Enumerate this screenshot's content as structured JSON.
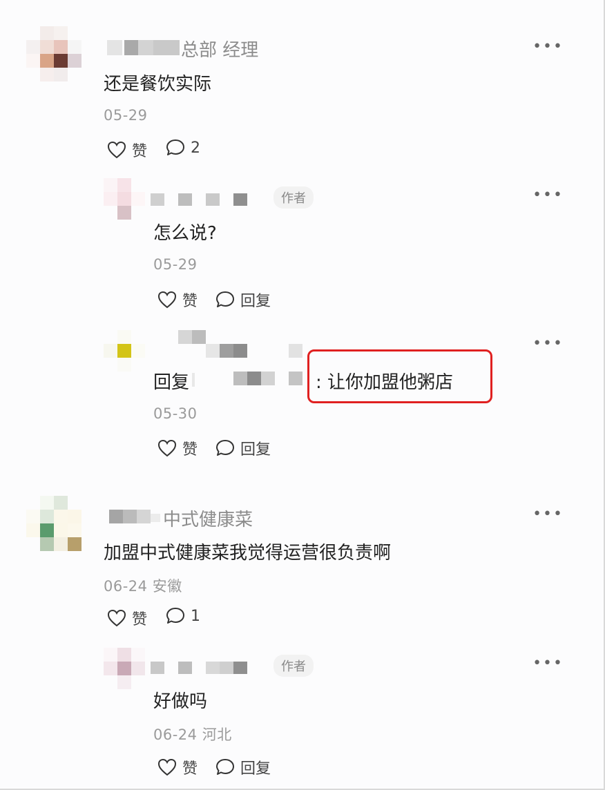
{
  "comments": [
    {
      "name": "总部 经理",
      "text": "还是餐饮实际",
      "date": "05-29",
      "like": "赞",
      "reply_count": "2"
    },
    {
      "name": "",
      "badge": "作者",
      "text": "怎么说?",
      "date": "05-29",
      "like": "赞",
      "reply": "回复"
    },
    {
      "name": "",
      "text_prefix": "回复",
      "text": ": 让你加盟他粥店",
      "date": "05-30",
      "like": "赞",
      "reply": "回复"
    },
    {
      "name": "中式健康菜",
      "text": "加盟中式健康菜我觉得运营很负责啊",
      "date": "06-24 安徽",
      "like": "赞",
      "reply_count": "1"
    },
    {
      "name": "",
      "badge": "作者",
      "text": "好做吗",
      "date": "06-24 河北",
      "like": "赞",
      "reply": "回复"
    }
  ],
  "more_icon": "more-icon",
  "icons": {
    "like": "heart-icon",
    "reply": "speech-bubble-icon"
  },
  "colors": {
    "highlight": "#e02020",
    "secondary_text": "#9a9a9a"
  }
}
